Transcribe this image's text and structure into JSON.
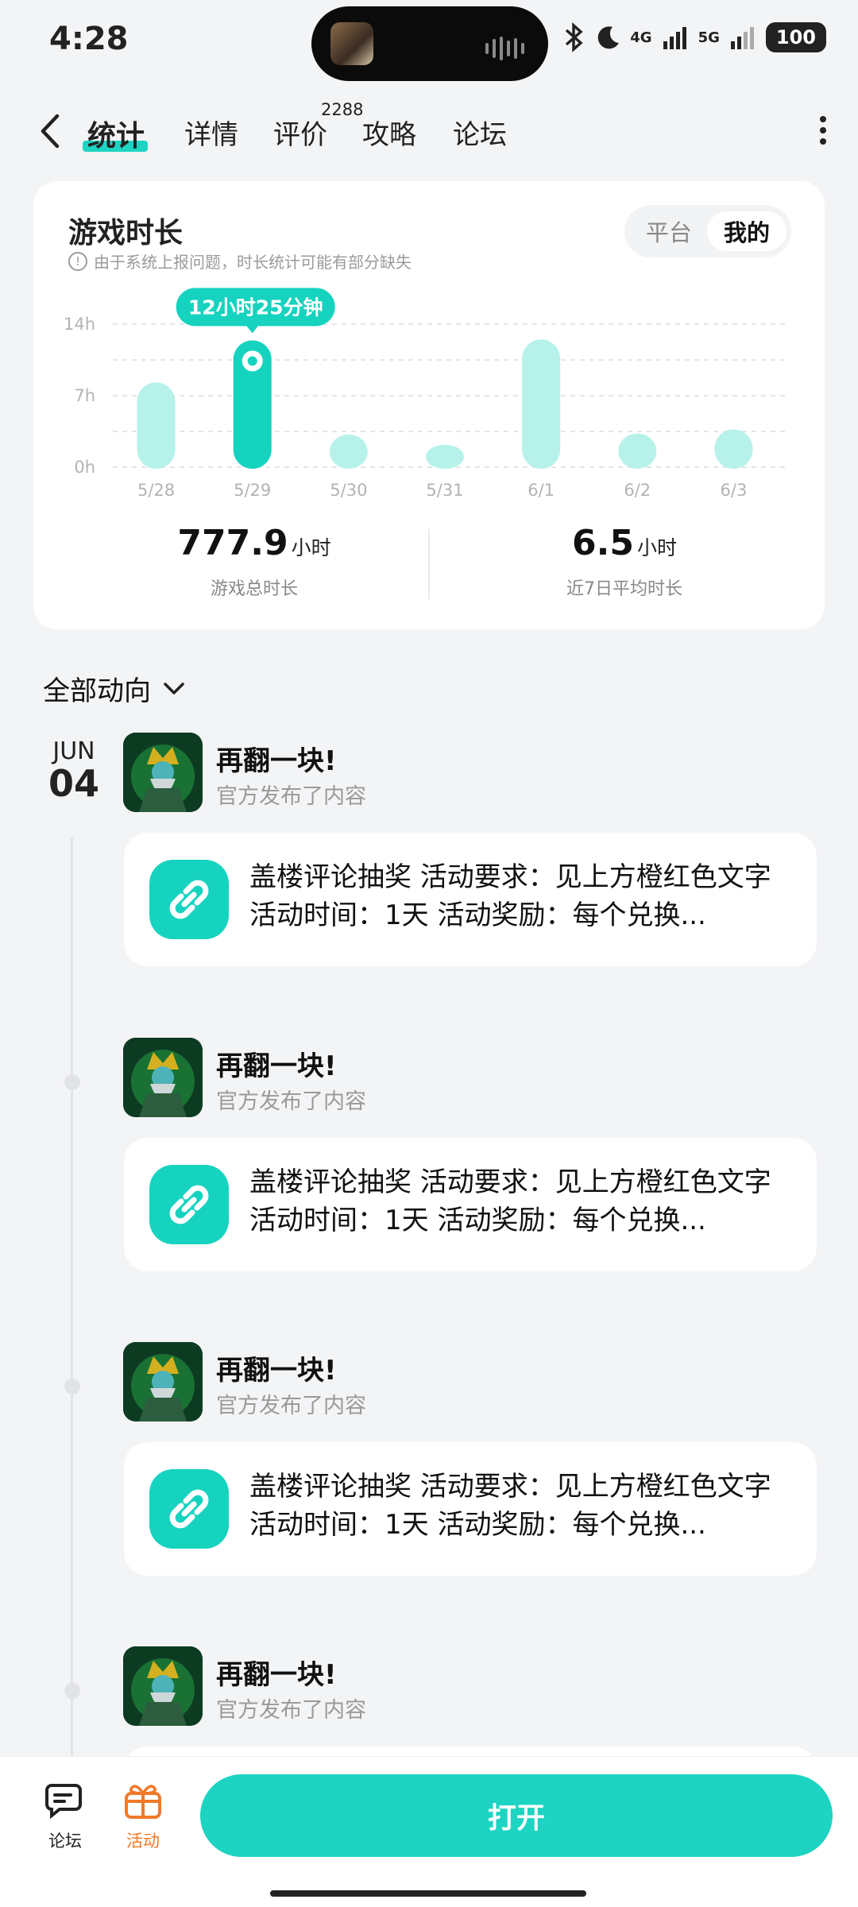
{
  "status_bar": {
    "time": "4:28",
    "net1": "4G",
    "net2": "5G",
    "battery": "100"
  },
  "nav": {
    "tabs": [
      "统计",
      "详情",
      "评价",
      "攻略",
      "论坛"
    ],
    "review_count": "2288"
  },
  "playtime": {
    "title": "游戏时长",
    "note": "由于系统上报问题，时长统计可能有部分缺失",
    "toggle": {
      "platform": "平台",
      "mine": "我的"
    },
    "total": {
      "value": "777.9",
      "unit": "小时",
      "label": "游戏总时长"
    },
    "average": {
      "value": "6.5",
      "unit": "小时",
      "label": "近7日平均时长"
    }
  },
  "chart_data": {
    "type": "bar",
    "categories": [
      "5/28",
      "5/29",
      "5/30",
      "5/31",
      "6/1",
      "6/2",
      "6/3"
    ],
    "values": [
      8.3,
      12.42,
      3.2,
      2.2,
      12.5,
      3.3,
      3.7
    ],
    "y_ticks": [
      "14h",
      "7h",
      "0h"
    ],
    "ylim": [
      0,
      14
    ],
    "highlight_index": 1,
    "highlight_label": "12小时25分钟",
    "colors": {
      "bar": "#b6f2ea",
      "highlight": "#16d3bf"
    }
  },
  "feed": {
    "filter_label": "全部动向",
    "date": {
      "month": "JUN",
      "day": "04"
    },
    "posts": [
      {
        "name": "再翻一块!",
        "sub": "官方发布了内容",
        "text": "盖楼评论抽奖 活动要求：见上方橙红色文字 活动时间：1天 活动奖励：每个兑换..."
      },
      {
        "name": "再翻一块!",
        "sub": "官方发布了内容",
        "text": "盖楼评论抽奖 活动要求：见上方橙红色文字 活动时间：1天 活动奖励：每个兑换..."
      },
      {
        "name": "再翻一块!",
        "sub": "官方发布了内容",
        "text": "盖楼评论抽奖 活动要求：见上方橙红色文字 活动时间：1天 活动奖励：每个兑换..."
      },
      {
        "name": "再翻一块!",
        "sub": "官方发布了内容",
        "text": ""
      }
    ]
  },
  "bottom": {
    "forum": "论坛",
    "activity": "活动",
    "open": "打开"
  }
}
